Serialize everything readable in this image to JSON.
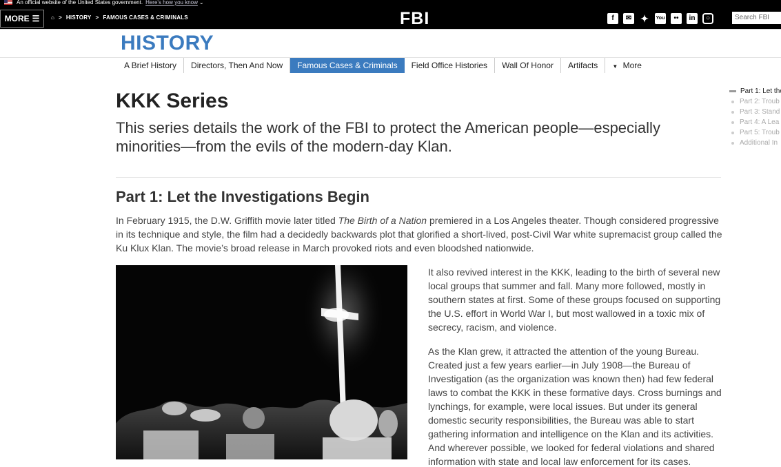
{
  "banner": {
    "text": "An official website of the United States government.",
    "link": "Here's how you know"
  },
  "header": {
    "more_label": "MORE",
    "breadcrumb": [
      "HISTORY",
      "FAMOUS CASES & CRIMINALS"
    ],
    "logo": "FBI",
    "search_placeholder": "Search FBI",
    "social": [
      "facebook-icon",
      "email-icon",
      "twitter-icon",
      "youtube-icon",
      "flickr-icon",
      "linkedin-icon",
      "instagram-icon"
    ]
  },
  "section_title": "HISTORY",
  "subnav": [
    {
      "label": "A Brief History"
    },
    {
      "label": "Directors, Then And Now"
    },
    {
      "label": "Famous Cases & Criminals",
      "active": true
    },
    {
      "label": "Field Office Histories"
    },
    {
      "label": "Wall Of Honor"
    },
    {
      "label": "Artifacts"
    },
    {
      "label": "More"
    }
  ],
  "toc": [
    "Part 1: Let the",
    "Part 2: Troub",
    "Part 3: Stand",
    "Part 4: A Lea",
    "Part 5: Troub",
    "Additional In"
  ],
  "page": {
    "title": "KKK Series",
    "lead": "This series details the work of the FBI to protect the American people—especially minorities—from the evils of the modern-day Klan.",
    "part_title": "Part 1: Let the Investigations Begin",
    "para1_before": "In February 1915, the D.W. Griffith movie later titled ",
    "para1_italic": "The Birth of a Nation",
    "para1_after": " premiered in a Los Angeles theater. Though considered progressive in its technique and style, the film had a decidedly backwards plot that glorified a short-lived, post-Civil War white supremacist group called the Ku Klux Klan. The movie’s broad release in March provoked riots and even bloodshed nationwide.",
    "para2": "It also revived interest in the KKK, leading to the birth of several new local groups that summer and fall. Many more followed, mostly in southern states at first. Some of these groups focused on supporting the U.S. effort in World War I, but most wallowed in a toxic mix of secrecy, racism, and violence.",
    "para3": "As the Klan grew, it attracted the attention of the young Bureau. Created just a few years earlier—in July 1908—the Bureau of Investigation (as the organization was known then) had few federal laws to combat the KKK in these formative days. Cross burnings and lynchings, for example, were local issues. But under its general domestic security responsibilities, the Bureau was able to start gathering information and intelligence on the Klan and its activities. And wherever possible, we looked for federal violations and shared information with state and local law enforcement for its cases."
  }
}
